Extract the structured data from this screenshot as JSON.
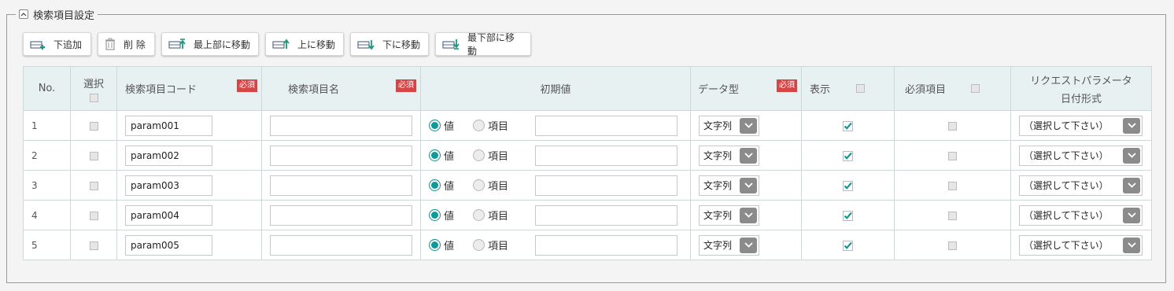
{
  "section": {
    "title": "検索項目設定"
  },
  "toolbar": {
    "add_below": "下追加",
    "delete": "削 除",
    "move_top": "最上部に移動",
    "move_up": "上に移動",
    "move_down": "下に移動",
    "move_bottom": "最下部に移動"
  },
  "table": {
    "headers": {
      "no": "No.",
      "select": "選択",
      "code": "検索項目コード",
      "name": "検索項目名",
      "initial": "初期値",
      "datatype": "データ型",
      "display": "表示",
      "required": "必須項目",
      "date_format_line1": "リクエストパラメータ",
      "date_format_line2": "日付形式"
    },
    "required_badge": "必須",
    "radio_value": "値",
    "radio_item": "項目",
    "rows": [
      {
        "no": "1",
        "code": "param001",
        "name": "",
        "initial": "",
        "datatype": "文字列",
        "display": true,
        "required": false,
        "date_format": "（選択して下さい）"
      },
      {
        "no": "2",
        "code": "param002",
        "name": "",
        "initial": "",
        "datatype": "文字列",
        "display": true,
        "required": false,
        "date_format": "（選択して下さい）"
      },
      {
        "no": "3",
        "code": "param003",
        "name": "",
        "initial": "",
        "datatype": "文字列",
        "display": true,
        "required": false,
        "date_format": "（選択して下さい）"
      },
      {
        "no": "4",
        "code": "param004",
        "name": "",
        "initial": "",
        "datatype": "文字列",
        "display": true,
        "required": false,
        "date_format": "（選択して下さい）"
      },
      {
        "no": "5",
        "code": "param005",
        "name": "",
        "initial": "",
        "datatype": "文字列",
        "display": true,
        "required": false,
        "date_format": "（選択して下さい）"
      }
    ]
  },
  "colors": {
    "accent": "#0e9a9a",
    "required": "#d64545",
    "header_bg": "#e8f1f1"
  }
}
